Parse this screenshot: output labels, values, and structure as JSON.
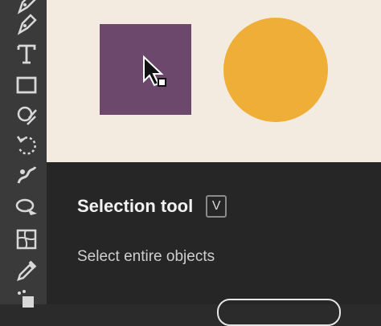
{
  "tooltip": {
    "title": "Selection tool",
    "shortcut": "V",
    "description": "Select entire objects"
  },
  "preview": {
    "square_color": "#6b486c",
    "circle_color": "#efae37",
    "background": "#f4ebe0"
  },
  "toolbar": {
    "tools": [
      "pen-icon",
      "type-icon",
      "rectangle-icon",
      "shaper-icon",
      "rotate-icon",
      "warp-icon",
      "lasso-shape-icon",
      "mesh-icon",
      "eyedropper-icon",
      "blend-icon"
    ]
  }
}
